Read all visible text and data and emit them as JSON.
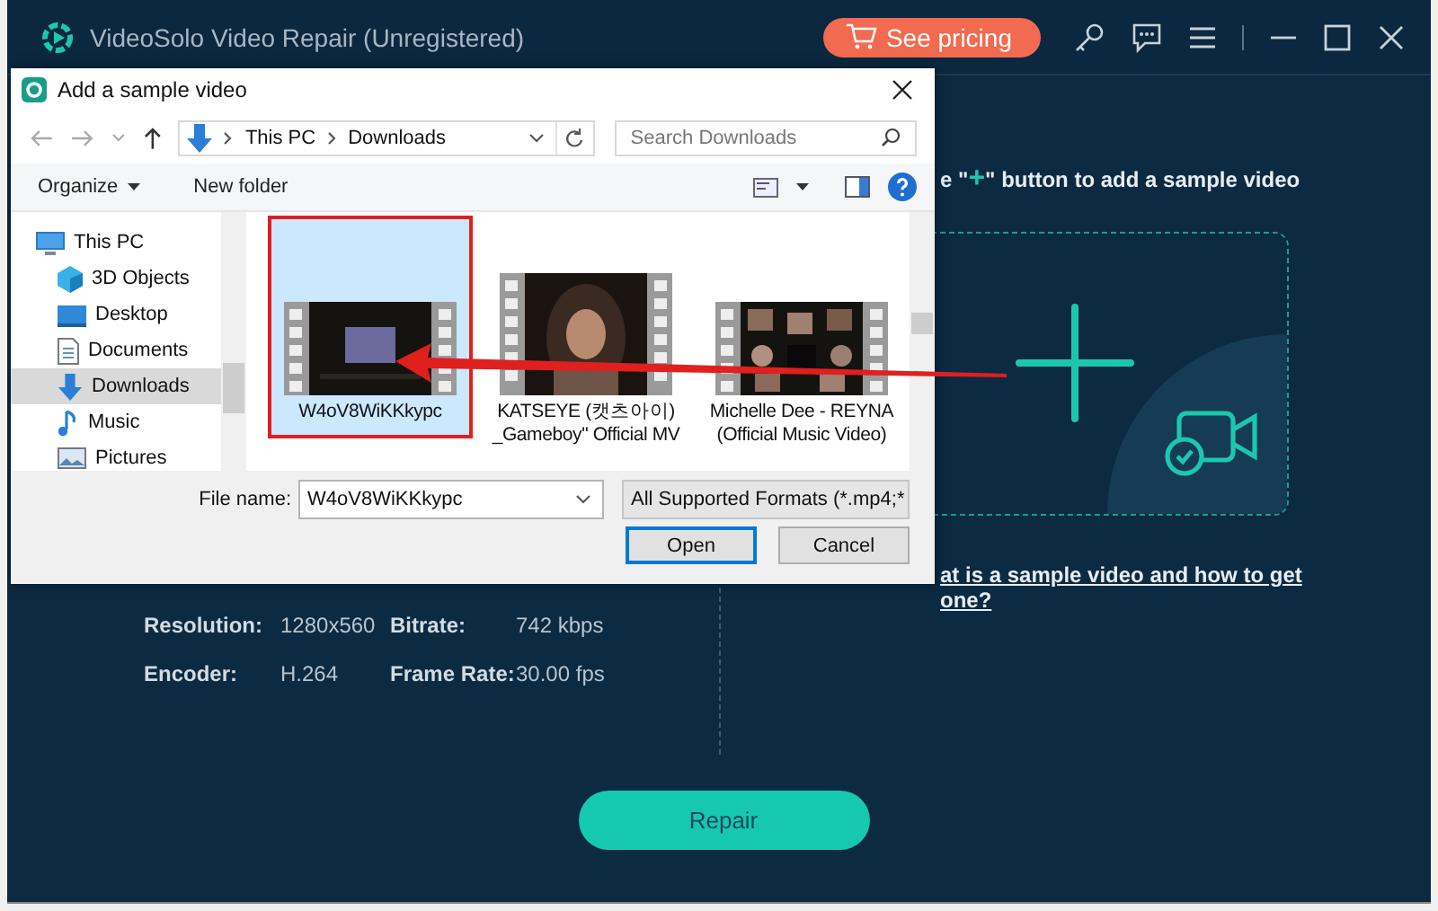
{
  "window": {
    "title": "VideoSolo Video Repair (Unregistered)",
    "pricing_button": "See pricing"
  },
  "dialog": {
    "title": "Add a sample video",
    "path": [
      "This PC",
      "Downloads"
    ],
    "search_placeholder": "Search Downloads",
    "organize": "Organize",
    "new_folder": "New folder",
    "nav": [
      {
        "label": "This PC",
        "kind": "pc",
        "selected": false,
        "children": [
          {
            "label": "3D Objects",
            "kind": "cube",
            "selected": false
          },
          {
            "label": "Desktop",
            "kind": "desktop",
            "selected": false
          },
          {
            "label": "Documents",
            "kind": "document",
            "selected": false
          },
          {
            "label": "Downloads",
            "kind": "download",
            "selected": true
          },
          {
            "label": "Music",
            "kind": "music",
            "selected": false
          },
          {
            "label": "Pictures",
            "kind": "pictures",
            "selected": false
          }
        ]
      }
    ],
    "files": [
      {
        "name": "W4oV8WiKKkypc",
        "selected": true
      },
      {
        "name": "KATSEYE (캣츠아이) _Gameboy\" Official MV",
        "selected": false
      },
      {
        "name": "Michelle Dee - REYNA (Official Music Video)",
        "selected": false
      }
    ],
    "file_name_label": "File name:",
    "file_name_value": "W4oV8WiKKkypc",
    "filter": "All Supported Formats (*.mp4;*",
    "open_button": "Open",
    "cancel_button": "Cancel"
  },
  "main": {
    "hint_prefix": "e \"",
    "hint_plus": "+",
    "hint_suffix": "\" button to add a sample video",
    "info": [
      {
        "label": "Resolution:",
        "value": "1280x560"
      },
      {
        "label": "Bitrate:",
        "value": "742 kbps"
      },
      {
        "label": "Encoder:",
        "value": "H.264"
      },
      {
        "label": "Frame Rate:",
        "value": "30.00 fps"
      }
    ],
    "help_link": "at is a sample video and how to get one?",
    "repair_button": "Repair"
  }
}
